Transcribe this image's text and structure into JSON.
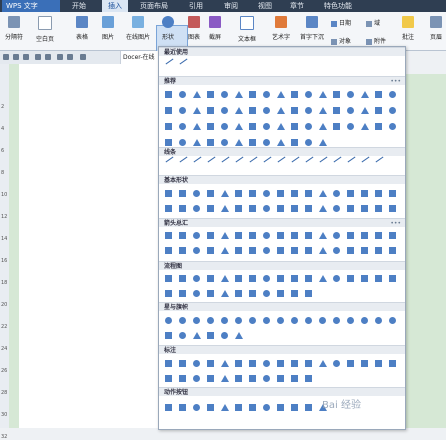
{
  "menubar": {
    "app": "WPS 文字",
    "tabs": [
      "开始",
      "插入",
      "页面布局",
      "引用",
      "审阅",
      "视图",
      "章节",
      "特色功能"
    ],
    "active_tab": "插入"
  },
  "ribbon": {
    "buttons": [
      "分隔符",
      "空白页",
      "表格",
      "图片",
      "在线图片",
      "形状",
      "图表",
      "截屏",
      "文本框",
      "艺术字",
      "首字下沉",
      "对象",
      "附件",
      "批注",
      "页眉"
    ],
    "small": [
      "日期",
      "域"
    ]
  },
  "quick": {
    "doc_tab": "Docer-在线"
  },
  "panel": {
    "sections": [
      "最近使用",
      "推荐",
      "线条",
      "基本形状",
      "箭头总汇",
      "流程图",
      "星与旗帜",
      "标注",
      "动作按钮"
    ]
  },
  "ruler": [
    "2",
    "4",
    "6",
    "8",
    "10",
    "12",
    "14",
    "16",
    "18",
    "20",
    "22",
    "24",
    "26",
    "28",
    "30",
    "32"
  ],
  "watermark": "Bai 经验"
}
